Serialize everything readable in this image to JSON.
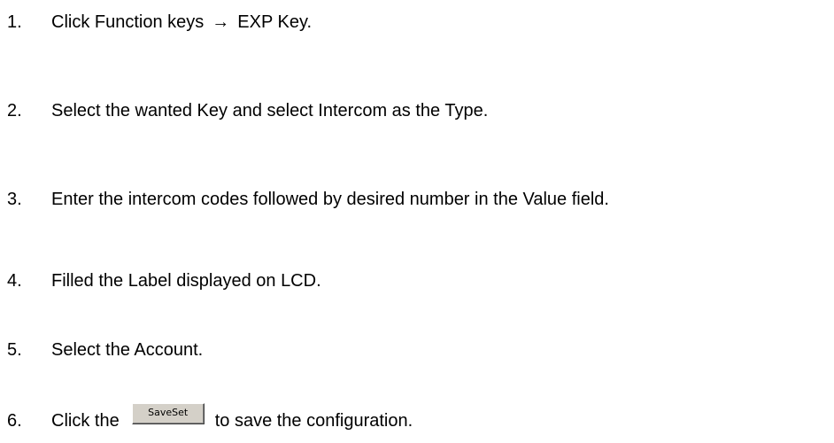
{
  "steps": [
    {
      "number": "1.",
      "text_before": "Click Function keys",
      "arrow": "→",
      "text_after": "EXP Key."
    },
    {
      "number": "2.",
      "text": "Select the wanted Key and select Intercom as the Type."
    },
    {
      "number": "3.",
      "text": "Enter the intercom codes followed by desired number in the Value field."
    },
    {
      "number": "4.",
      "text": "Filled the Label displayed on LCD."
    },
    {
      "number": "5.",
      "text": "Select the Account."
    },
    {
      "number": "6.",
      "text_before": "Click the",
      "button_label": "SaveSet",
      "text_after": "to save the configuration."
    }
  ],
  "colors": {
    "text": "#000000",
    "background": "#ffffff",
    "button_face": "#d4d0c8"
  }
}
